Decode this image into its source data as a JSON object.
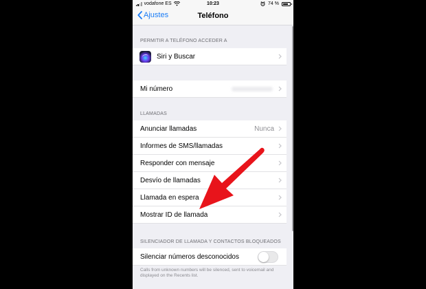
{
  "status": {
    "carrier": "vodafone ES",
    "time": "10:23",
    "battery_text": "74 %",
    "battery_level": 0.74
  },
  "nav": {
    "back_label": "Ajustes",
    "title": "Teléfono"
  },
  "sections": {
    "allow_access": {
      "header": "PERMITIR A TELÉFONO ACCEDER A",
      "siri_label": "Siri y Buscar"
    },
    "number": {
      "label": "Mi número"
    },
    "calls": {
      "header": "LLAMADAS",
      "items": [
        {
          "label": "Anunciar llamadas",
          "detail": "Nunca"
        },
        {
          "label": "Informes de SMS/llamadas"
        },
        {
          "label": "Responder con mensaje"
        },
        {
          "label": "Desvío de llamadas"
        },
        {
          "label": "Llamada en espera"
        },
        {
          "label": "Mostrar ID de llamada"
        }
      ]
    },
    "silencing": {
      "header": "SILENCIADOR DE LLAMADA Y CONTACTOS BLOQUEADOS",
      "toggle_label": "Silenciar números desconocidos",
      "toggle_on": false,
      "footer": "Calls from unknown numbers will be silenced, sent to voicemail and displayed on the Recents list."
    }
  },
  "icons": [
    "signal-icon",
    "wifi-icon",
    "alarm-icon",
    "battery-icon",
    "chevron-left-icon",
    "chevron-right-icon",
    "siri-icon",
    "red-arrow-annotation"
  ],
  "colors": {
    "ios_blue": "#1a7cf6",
    "annotation_red": "#e8141b",
    "group_background": "#efeff4"
  }
}
